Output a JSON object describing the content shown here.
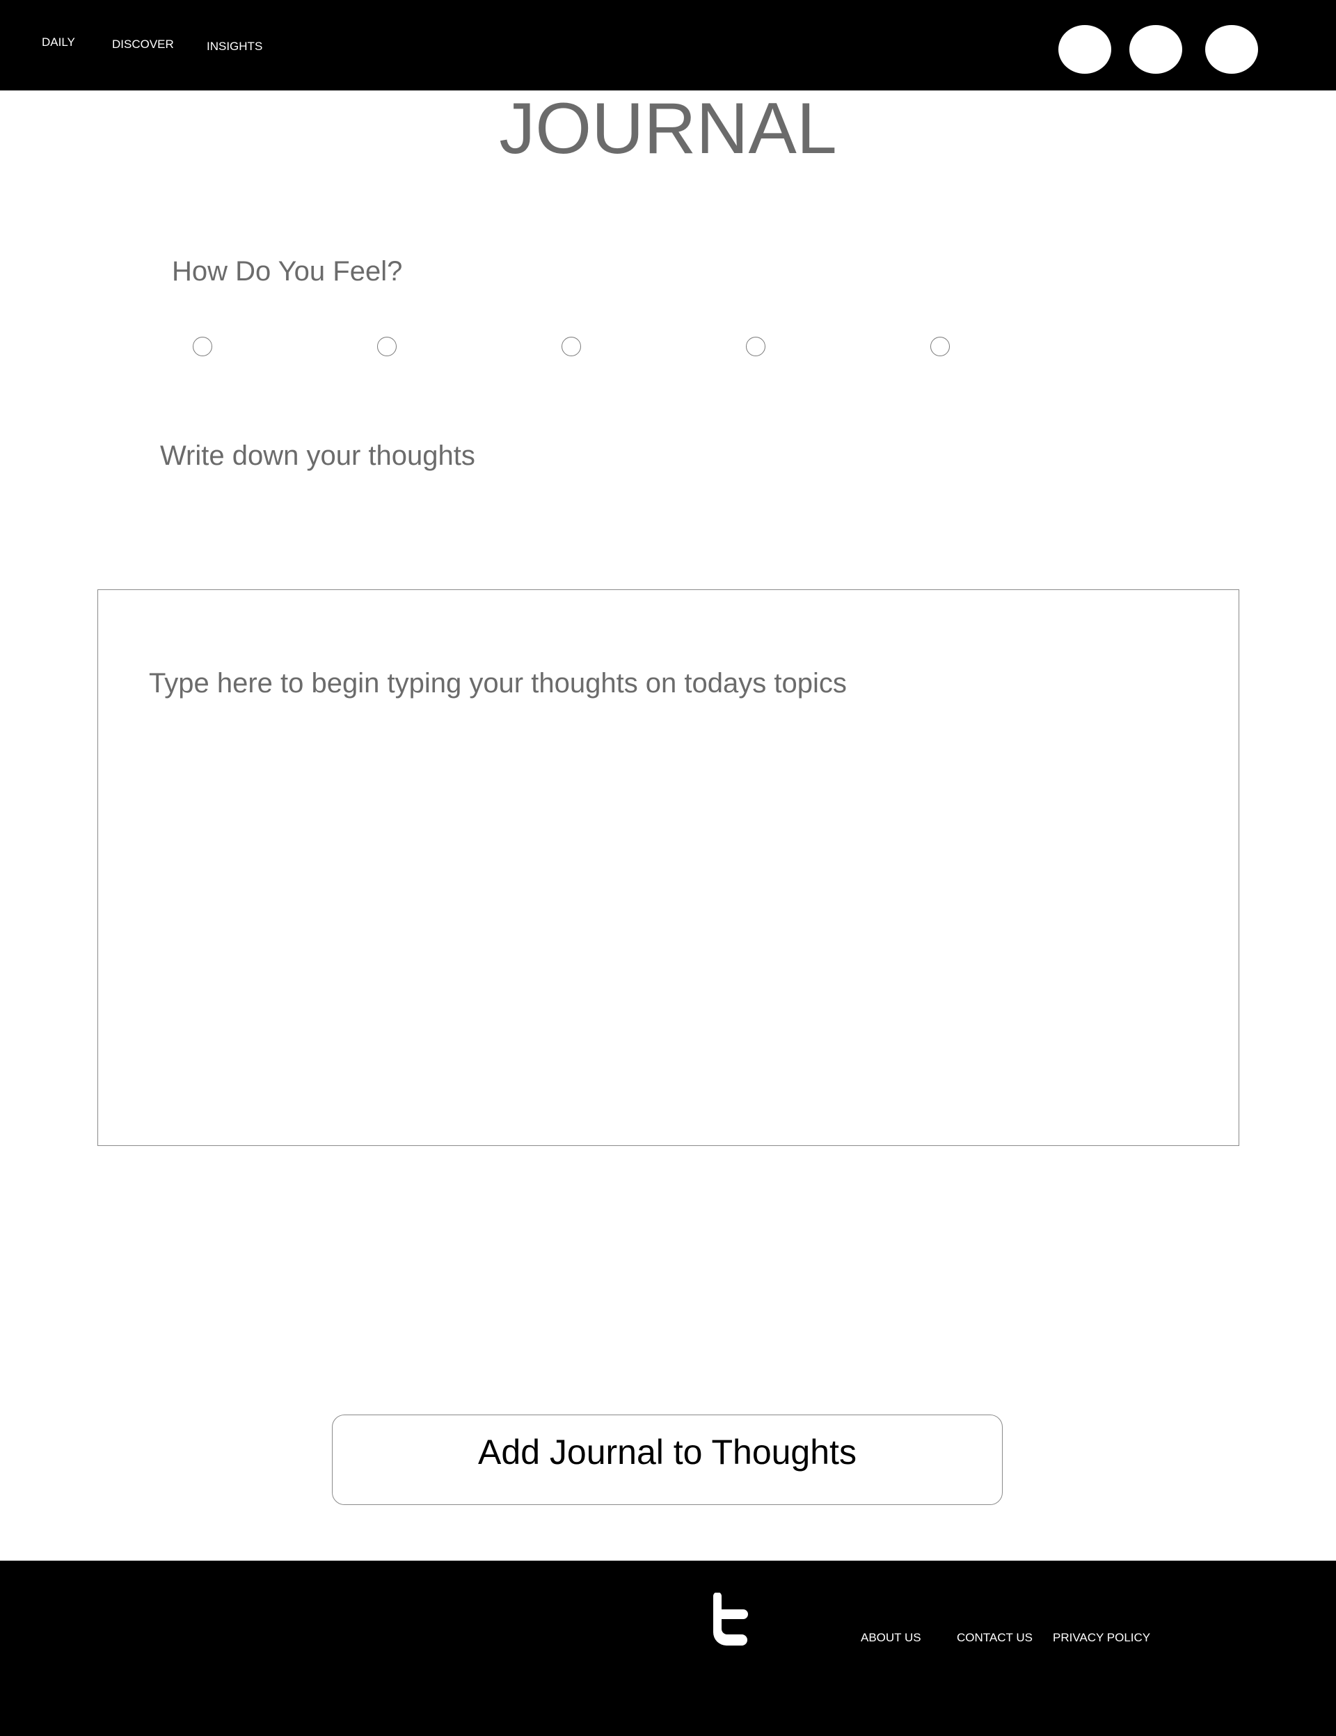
{
  "nav": {
    "items": [
      {
        "label": "DAILY"
      },
      {
        "label": "DISCOVER"
      },
      {
        "label": "INSIGHTS"
      }
    ]
  },
  "header": {
    "title": "JOURNAL"
  },
  "mood": {
    "question": "How Do You Feel?",
    "options_count": 5
  },
  "thoughts": {
    "label": "Write down your thoughts",
    "placeholder": "Type here to begin typing your thoughts on todays topics"
  },
  "actions": {
    "add_label": "Add Journal to Thoughts"
  },
  "footer": {
    "links": [
      {
        "label": "ABOUT US"
      },
      {
        "label": "CONTACT US"
      },
      {
        "label": "PRIVACY POLICY"
      }
    ],
    "social_icon": "twitter-icon"
  },
  "colors": {
    "bar_background": "#000000",
    "text_gray": "#6b6b6b",
    "border_gray": "#8a8a8a"
  }
}
